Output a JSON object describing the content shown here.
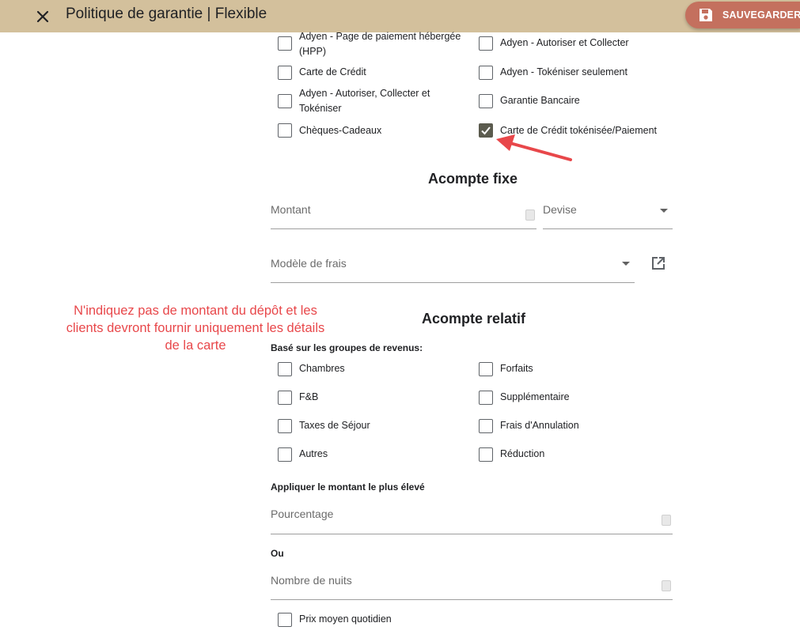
{
  "header": {
    "title": "Politique de garantie | Flexible",
    "save_label": "SAUVEGARDER"
  },
  "payment_methods": {
    "left": [
      {
        "label": "Adyen - Page de paiement hébergée (HPP)",
        "checked": false
      },
      {
        "label": "Carte de Crédit",
        "checked": false
      },
      {
        "label": "Adyen - Autoriser, Collecter et Tokéniser",
        "checked": false
      },
      {
        "label": "Chèques-Cadeaux",
        "checked": false
      }
    ],
    "right": [
      {
        "label": "Adyen - Autoriser et Collecter",
        "checked": false
      },
      {
        "label": "Adyen - Tokéniser seulement",
        "checked": false
      },
      {
        "label": "Garantie Bancaire",
        "checked": false
      },
      {
        "label": "Carte de Crédit tokénisée/Paiement",
        "checked": true
      }
    ]
  },
  "fixed_deposit": {
    "title": "Acompte fixe",
    "amount_label": "Montant",
    "currency_label": "Devise",
    "fee_model_label": "Modèle de frais"
  },
  "relative_deposit": {
    "title": "Acompte relatif",
    "revenue_groups_label": "Basé sur les groupes de revenus:",
    "groups_left": [
      {
        "label": "Chambres",
        "checked": false
      },
      {
        "label": "F&B",
        "checked": false
      },
      {
        "label": "Taxes de Séjour",
        "checked": false
      },
      {
        "label": "Autres",
        "checked": false
      }
    ],
    "groups_right": [
      {
        "label": "Forfaits",
        "checked": false
      },
      {
        "label": "Supplémentaire",
        "checked": false
      },
      {
        "label": "Frais d'Annulation",
        "checked": false
      },
      {
        "label": "Réduction",
        "checked": false
      }
    ],
    "apply_highest_label": "Appliquer le montant le plus élevé",
    "percentage_label": "Pourcentage",
    "or_label": "Ou",
    "nights_label": "Nombre de nuits",
    "avg_daily_price": {
      "label": "Prix moyen quotidien",
      "checked": false
    }
  },
  "annotation": {
    "line1": "N'indiquez pas de montant du dépôt et les",
    "line2": "clients devront fournir uniquement les détails",
    "line3": "de la carte",
    "color": "#e8474a"
  },
  "colors": {
    "header_bg": "#d3c09c",
    "save_button": "#c4705e",
    "checked_box": "#5b5b4e"
  },
  "icons": {
    "close": "close-icon",
    "save": "floppy-disk-icon",
    "external": "open-in-new-icon",
    "dropdown": "caret-down-icon",
    "spinner": "spinner-arrows-icon",
    "check": "check-icon",
    "arrow": "red-arrow-icon"
  }
}
